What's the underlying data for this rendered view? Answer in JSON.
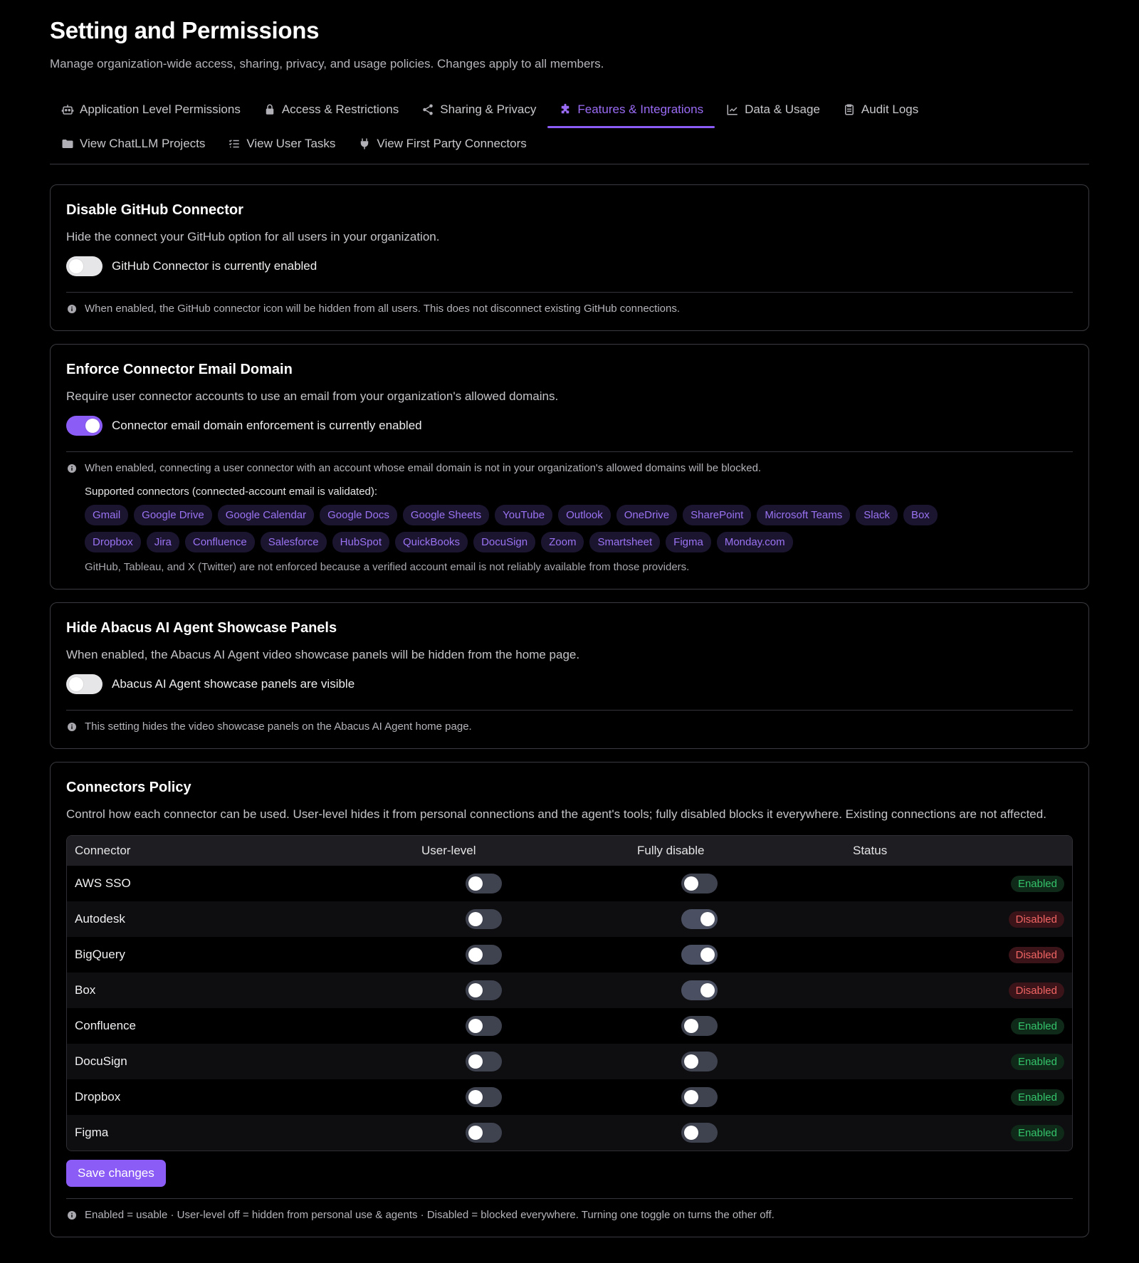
{
  "header": {
    "title": "Setting and Permissions",
    "subtitle": "Manage organization-wide access, sharing, privacy, and usage policies. Changes apply to all members."
  },
  "tabs": [
    {
      "label": "Application Level Permissions",
      "icon": "robot-icon",
      "active": false
    },
    {
      "label": "Access & Restrictions",
      "icon": "lock-icon",
      "active": false
    },
    {
      "label": "Sharing & Privacy",
      "icon": "share-icon",
      "active": false
    },
    {
      "label": "Features & Integrations",
      "icon": "puzzle-icon",
      "active": true
    },
    {
      "label": "Data & Usage",
      "icon": "chart-icon",
      "active": false
    },
    {
      "label": "Audit Logs",
      "icon": "clipboard-icon",
      "active": false
    },
    {
      "label": "View ChatLLM Projects",
      "icon": "folder-icon",
      "active": false
    },
    {
      "label": "View User Tasks",
      "icon": "list-check-icon",
      "active": false
    },
    {
      "label": "View First Party Connectors",
      "icon": "plug-icon",
      "active": false
    }
  ],
  "github": {
    "title": "Disable GitHub Connector",
    "desc": "Hide the connect your GitHub option for all users in your organization.",
    "toggle_label": "GitHub Connector is currently enabled",
    "info": "When enabled, the GitHub connector icon will be hidden from all users. This does not disconnect existing GitHub connections."
  },
  "email_domain": {
    "title": "Enforce Connector Email Domain",
    "desc": "Require user connector accounts to use an email from your organization's allowed domains.",
    "toggle_label": "Connector email domain enforcement is currently enabled",
    "info": "When enabled, connecting a user connector with an account whose email domain is not in your organization's allowed domains will be blocked.",
    "supported_label": "Supported connectors (connected-account email is validated):",
    "chips": [
      "Gmail",
      "Google Drive",
      "Google Calendar",
      "Google Docs",
      "Google Sheets",
      "YouTube",
      "Outlook",
      "OneDrive",
      "SharePoint",
      "Microsoft Teams",
      "Slack",
      "Box",
      "Dropbox",
      "Jira",
      "Confluence",
      "Salesforce",
      "HubSpot",
      "QuickBooks",
      "DocuSign",
      "Zoom",
      "Smartsheet",
      "Figma",
      "Monday.com"
    ],
    "note": "GitHub, Tableau, and X (Twitter) are not enforced because a verified account email is not reliably available from those providers."
  },
  "showcase": {
    "title": "Hide Abacus AI Agent Showcase Panels",
    "desc": "When enabled, the Abacus AI Agent video showcase panels will be hidden from the home page.",
    "toggle_label": "Abacus AI Agent showcase panels are visible",
    "info": "This setting hides the video showcase panels on the Abacus AI Agent home page."
  },
  "policy": {
    "title": "Connectors Policy",
    "desc": "Control how each connector can be used. User-level hides it from personal connections and the agent's tools; fully disabled blocks it everywhere. Existing connections are not affected.",
    "columns": [
      "Connector",
      "User-level",
      "Fully disable",
      "Status"
    ],
    "rows": [
      {
        "name": "AWS SSO",
        "user_level": false,
        "fully_disable": false,
        "status": "Enabled"
      },
      {
        "name": "Autodesk",
        "user_level": false,
        "fully_disable": true,
        "status": "Disabled"
      },
      {
        "name": "BigQuery",
        "user_level": false,
        "fully_disable": true,
        "status": "Disabled"
      },
      {
        "name": "Box",
        "user_level": false,
        "fully_disable": true,
        "status": "Disabled"
      },
      {
        "name": "Confluence",
        "user_level": false,
        "fully_disable": false,
        "status": "Enabled"
      },
      {
        "name": "DocuSign",
        "user_level": false,
        "fully_disable": false,
        "status": "Enabled"
      },
      {
        "name": "Dropbox",
        "user_level": false,
        "fully_disable": false,
        "status": "Enabled"
      },
      {
        "name": "Figma",
        "user_level": false,
        "fully_disable": false,
        "status": "Enabled"
      }
    ],
    "save_label": "Save changes",
    "info": "Enabled = usable · User-level off = hidden from personal use & agents · Disabled = blocked everywhere. Turning one toggle on turns the other off."
  },
  "colors": {
    "accent": "#8b5cf6",
    "enabled": "#34c36b",
    "disabled": "#f06464",
    "background": "#000000"
  }
}
